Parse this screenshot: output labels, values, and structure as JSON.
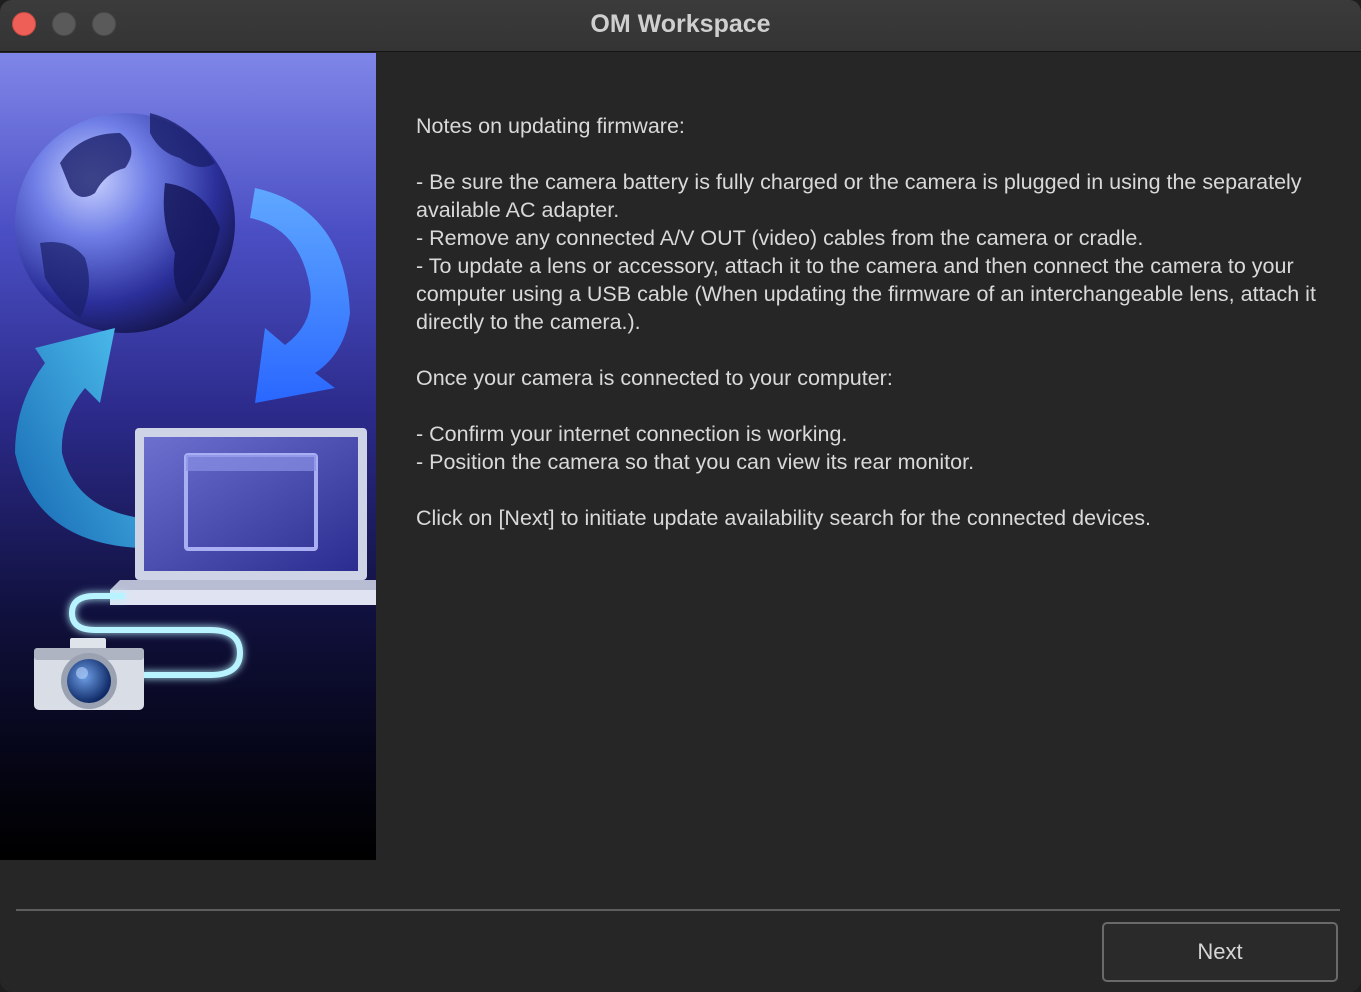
{
  "window": {
    "title": "OM Workspace"
  },
  "illustration": {
    "icons": [
      "globe-icon",
      "arrow-icon",
      "laptop-icon",
      "usb-cable-icon",
      "camera-icon"
    ]
  },
  "notes": {
    "heading": "Notes on updating firmware:",
    "bullets": [
      "- Be sure the camera battery is fully charged or the camera is plugged in using the separately available AC adapter.",
      "- Remove any connected A/V OUT (video) cables from the camera or cradle.",
      "- To update a lens or accessory, attach it to the camera and then connect the camera to your computer using a USB cable (When updating the firmware of an interchangeable lens, attach it directly to the camera.)."
    ],
    "connected_heading": "Once your camera is connected to your computer:",
    "connected_bullets": [
      "- Confirm your internet connection is working.",
      "- Position the camera so that you can view its rear monitor."
    ],
    "instruction": "Click on [Next] to initiate update availability search for the connected devices."
  },
  "footer": {
    "next_label": "Next"
  },
  "colors": {
    "close": "#ed5f57",
    "background": "#262626",
    "text": "#d9d9d9"
  }
}
